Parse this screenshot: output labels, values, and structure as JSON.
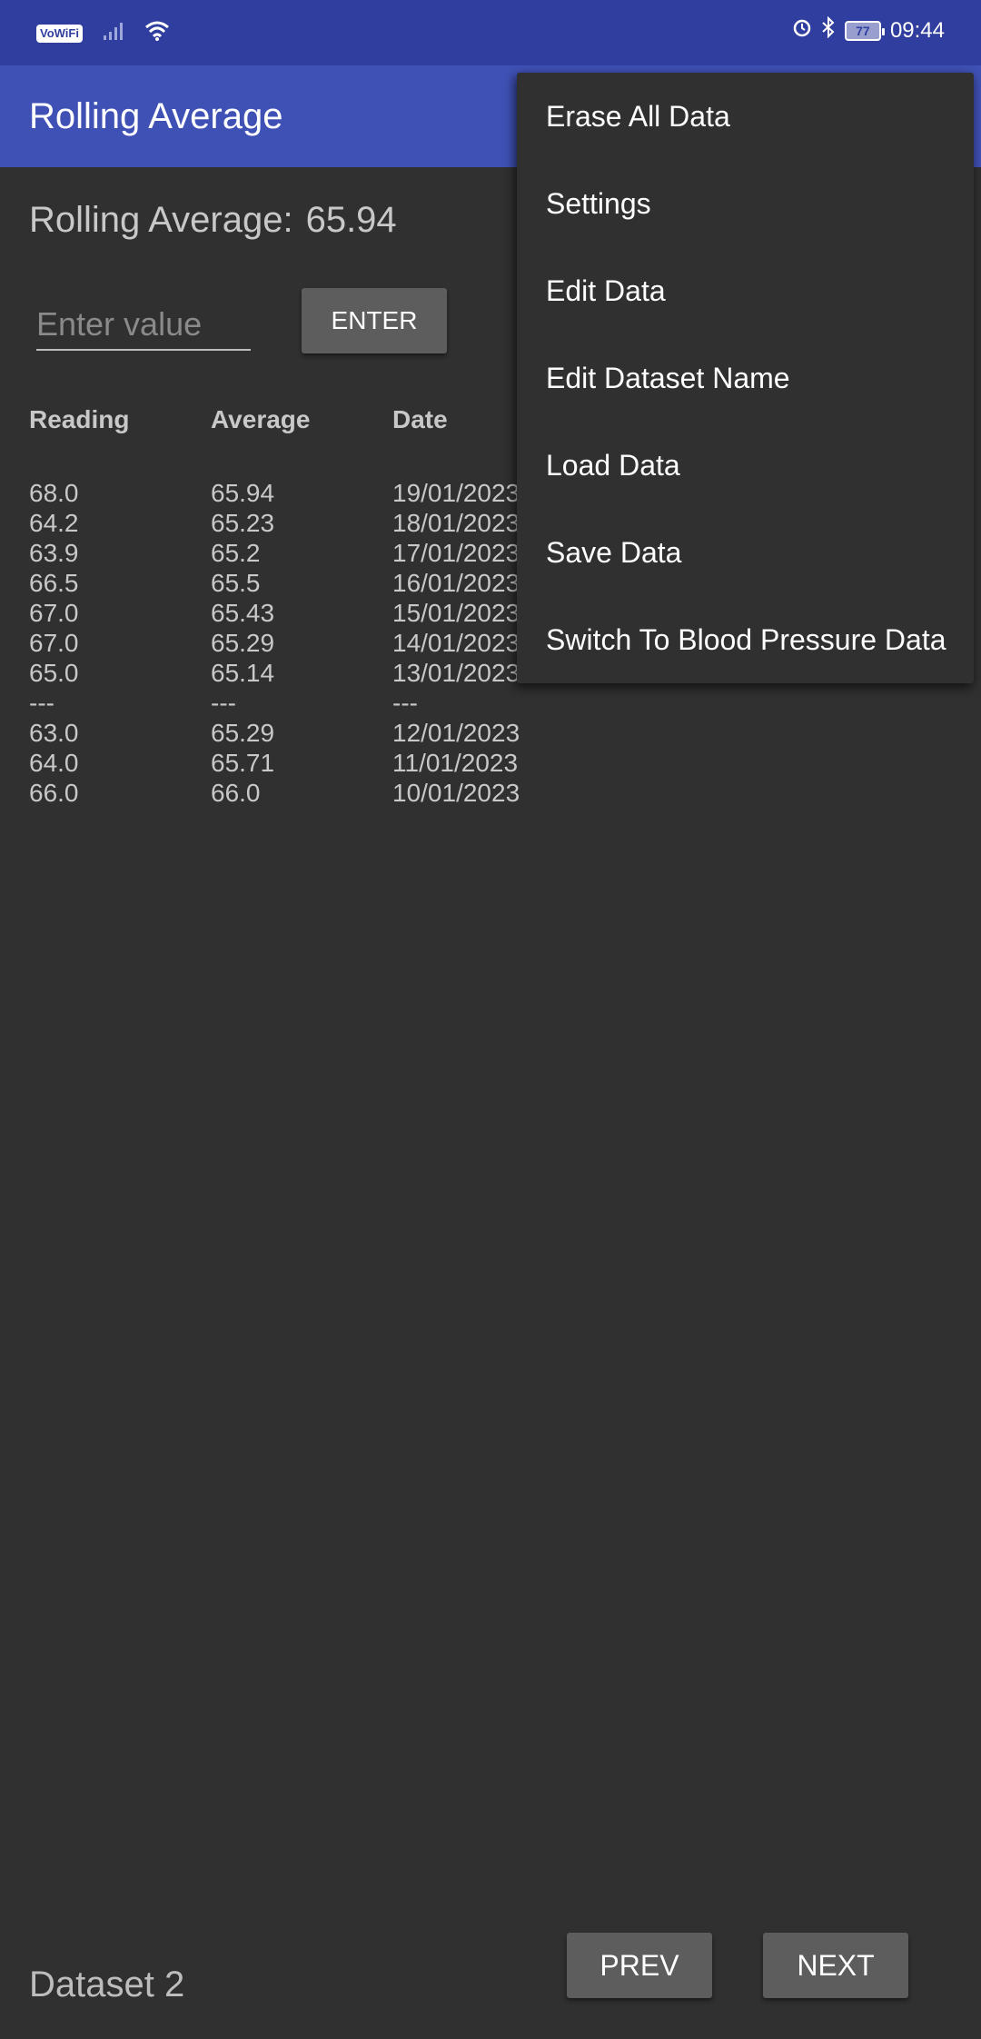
{
  "status_bar": {
    "left_badge": "VoWiFi",
    "battery": "77",
    "time": "09:44"
  },
  "app_bar": {
    "title": "Rolling Average"
  },
  "summary": {
    "label": "Rolling Average:",
    "value": "65.94"
  },
  "input": {
    "placeholder": "Enter value",
    "value": ""
  },
  "enter_button": "ENTER",
  "table": {
    "headers": [
      "Reading",
      "Average",
      "Date"
    ],
    "rows": [
      [
        "68.0",
        "65.94",
        "19/01/2023"
      ],
      [
        "64.2",
        "65.23",
        "18/01/2023"
      ],
      [
        "63.9",
        "65.2",
        "17/01/2023"
      ],
      [
        "66.5",
        "65.5",
        "16/01/2023"
      ],
      [
        "67.0",
        "65.43",
        "15/01/2023"
      ],
      [
        "67.0",
        "65.29",
        "14/01/2023"
      ],
      [
        "65.0",
        "65.14",
        "13/01/2023"
      ],
      [
        "---",
        "---",
        "---"
      ],
      [
        "63.0",
        "65.29",
        "12/01/2023"
      ],
      [
        "64.0",
        "65.71",
        "11/01/2023"
      ],
      [
        "66.0",
        "66.0",
        "10/01/2023"
      ]
    ]
  },
  "footer": {
    "dataset_name": "Dataset 2",
    "prev_label": "PREV",
    "next_label": "NEXT"
  },
  "menu": {
    "items": [
      "Erase All Data",
      "Settings",
      "Edit Data",
      "Edit Dataset Name",
      "Load Data",
      "Save Data",
      "Switch To Blood Pressure Data"
    ]
  }
}
